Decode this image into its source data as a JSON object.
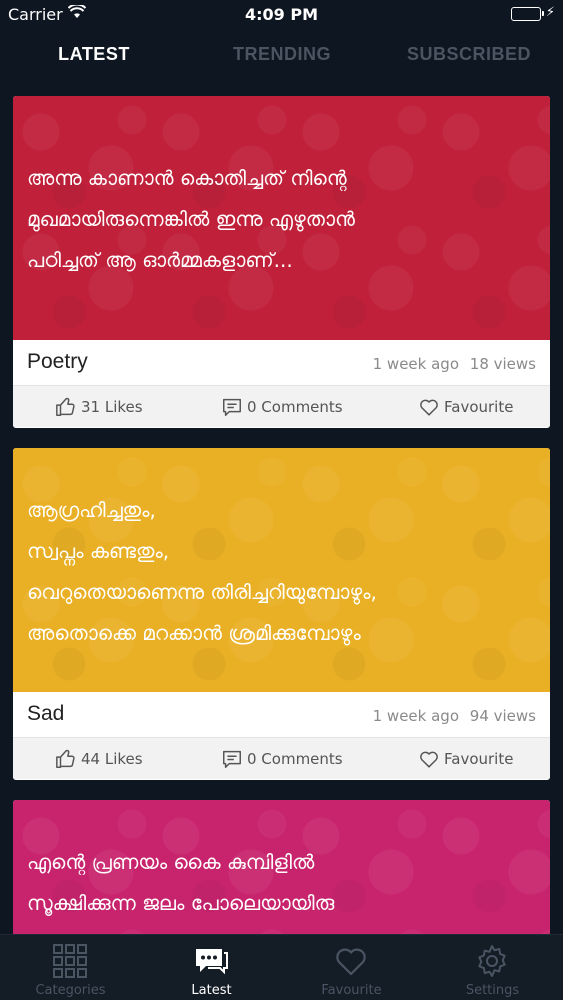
{
  "status": {
    "carrier": "Carrier",
    "time": "4:09 PM"
  },
  "tabs": [
    {
      "label": "LATEST",
      "active": true
    },
    {
      "label": "TRENDING",
      "active": false
    },
    {
      "label": "SUBSCRIBED",
      "active": false
    }
  ],
  "posts": [
    {
      "color": "#c0203a",
      "lines": [
        "അന്നു കാണാൻ കൊതിച്ചത് നിന്റെ",
        "മുഖമായിരുന്നെങ്കിൽ ഇന്നു എഴുതാൻ",
        " പഠിച്ചത് ആ ഓർമ്മകളാണ്..."
      ],
      "category": "Poetry",
      "time_ago": "1 week ago",
      "views": "18 views",
      "likes": "31 Likes",
      "comments": "0 Comments",
      "favourite": "Favourite"
    },
    {
      "color": "#e9b025",
      "lines": [
        "ആഗ്രഹിച്ചതും,",
        "സ്വപ്നം കണ്ടതും,",
        "വെറുതെയാണെന്നു തിരിച്ചറിയുമ്പോഴും,",
        "അതൊക്കെ മറക്കാൻ ശ്രമിക്കുമ്പോഴും"
      ],
      "category": "Sad",
      "time_ago": "1 week ago",
      "views": "94 views",
      "likes": "44 Likes",
      "comments": "0 Comments",
      "favourite": "Favourite"
    },
    {
      "color": "#c8246d",
      "lines": [
        "എന്റെ പ്രണയം കൈ കുമ്പിളിൽ",
        "സൂക്ഷിക്കുന്ന ജലം പോലെയായിരു"
      ]
    }
  ],
  "tabbar": [
    {
      "label": "Categories",
      "icon": "grid-icon",
      "active": false
    },
    {
      "label": "Latest",
      "icon": "chat-bubbles-icon",
      "active": true
    },
    {
      "label": "Favourite",
      "icon": "heart-icon",
      "active": false
    },
    {
      "label": "Settings",
      "icon": "gear-icon",
      "active": false
    }
  ]
}
